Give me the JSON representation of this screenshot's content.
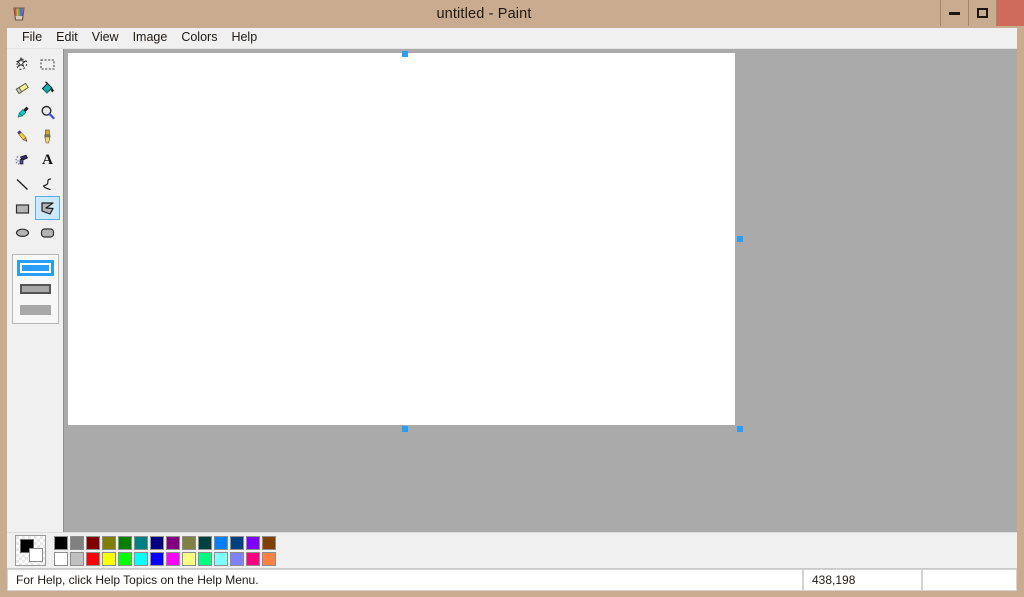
{
  "window": {
    "title": "untitled - Paint",
    "icon": "paint-cup-icon",
    "controls": {
      "minimize_label": "Minimize",
      "maximize_label": "Maximize",
      "close_label": "Close"
    },
    "titlebar_color": "#c9ab8f",
    "close_color": "#cf6b5c"
  },
  "menu": {
    "items": [
      {
        "label": "File"
      },
      {
        "label": "Edit"
      },
      {
        "label": "View"
      },
      {
        "label": "Image"
      },
      {
        "label": "Colors"
      },
      {
        "label": "Help"
      }
    ]
  },
  "toolbox": {
    "tools": [
      {
        "name": "free-form-select-tool",
        "icon": "free-form-select-icon",
        "selected": false
      },
      {
        "name": "rectangle-select-tool",
        "icon": "rectangle-select-icon",
        "selected": false
      },
      {
        "name": "eraser-tool",
        "icon": "eraser-icon",
        "selected": false
      },
      {
        "name": "fill-tool",
        "icon": "paint-bucket-icon",
        "selected": false
      },
      {
        "name": "pick-color-tool",
        "icon": "eyedropper-icon",
        "selected": false
      },
      {
        "name": "magnifier-tool",
        "icon": "magnifier-icon",
        "selected": false
      },
      {
        "name": "pencil-tool",
        "icon": "pencil-icon",
        "selected": false
      },
      {
        "name": "brush-tool",
        "icon": "paintbrush-icon",
        "selected": false
      },
      {
        "name": "airbrush-tool",
        "icon": "airbrush-icon",
        "selected": false
      },
      {
        "name": "text-tool",
        "icon": "text-a-icon",
        "selected": false
      },
      {
        "name": "line-tool",
        "icon": "line-icon",
        "selected": false
      },
      {
        "name": "curve-tool",
        "icon": "curve-icon",
        "selected": false
      },
      {
        "name": "rectangle-tool",
        "icon": "rectangle-icon",
        "selected": false
      },
      {
        "name": "polygon-tool",
        "icon": "polygon-icon",
        "selected": true
      },
      {
        "name": "ellipse-tool",
        "icon": "ellipse-icon",
        "selected": false
      },
      {
        "name": "rounded-rectangle-tool",
        "icon": "rounded-rectangle-icon",
        "selected": false
      }
    ],
    "fill_options": [
      {
        "name": "outline-only-option",
        "selected": true
      },
      {
        "name": "outline-and-fill-option",
        "selected": false
      },
      {
        "name": "fill-only-option",
        "selected": false
      }
    ],
    "selected_tool": "polygon-tool",
    "highlight_color": "#2a9df4"
  },
  "canvas": {
    "background_color": "#ffffff",
    "workspace_color": "#aaaaaa",
    "handle_color": "#2a9df4",
    "handles": [
      "top-center",
      "right-middle",
      "bottom-right",
      "bottom-center"
    ]
  },
  "palette": {
    "primary_color": "#000000",
    "secondary_color": "#ffffff",
    "swatches": [
      {
        "top": "#000000",
        "bottom": "#ffffff"
      },
      {
        "top": "#808080",
        "bottom": "#c0c0c0"
      },
      {
        "top": "#800000",
        "bottom": "#ff0000"
      },
      {
        "top": "#808000",
        "bottom": "#ffff00"
      },
      {
        "top": "#008000",
        "bottom": "#00ff00"
      },
      {
        "top": "#008080",
        "bottom": "#00ffff"
      },
      {
        "top": "#000080",
        "bottom": "#0000ff"
      },
      {
        "top": "#800080",
        "bottom": "#ff00ff"
      },
      {
        "top": "#808040",
        "bottom": "#ffff80"
      },
      {
        "top": "#004040",
        "bottom": "#00ff80"
      },
      {
        "top": "#0080ff",
        "bottom": "#80ffff"
      },
      {
        "top": "#004080",
        "bottom": "#8080ff"
      },
      {
        "top": "#8000ff",
        "bottom": "#ff0080"
      },
      {
        "top": "#804000",
        "bottom": "#ff8040"
      }
    ]
  },
  "statusbar": {
    "help_text": "For Help, click Help Topics on the Help Menu.",
    "coordinates": "438,198",
    "size_text": ""
  }
}
